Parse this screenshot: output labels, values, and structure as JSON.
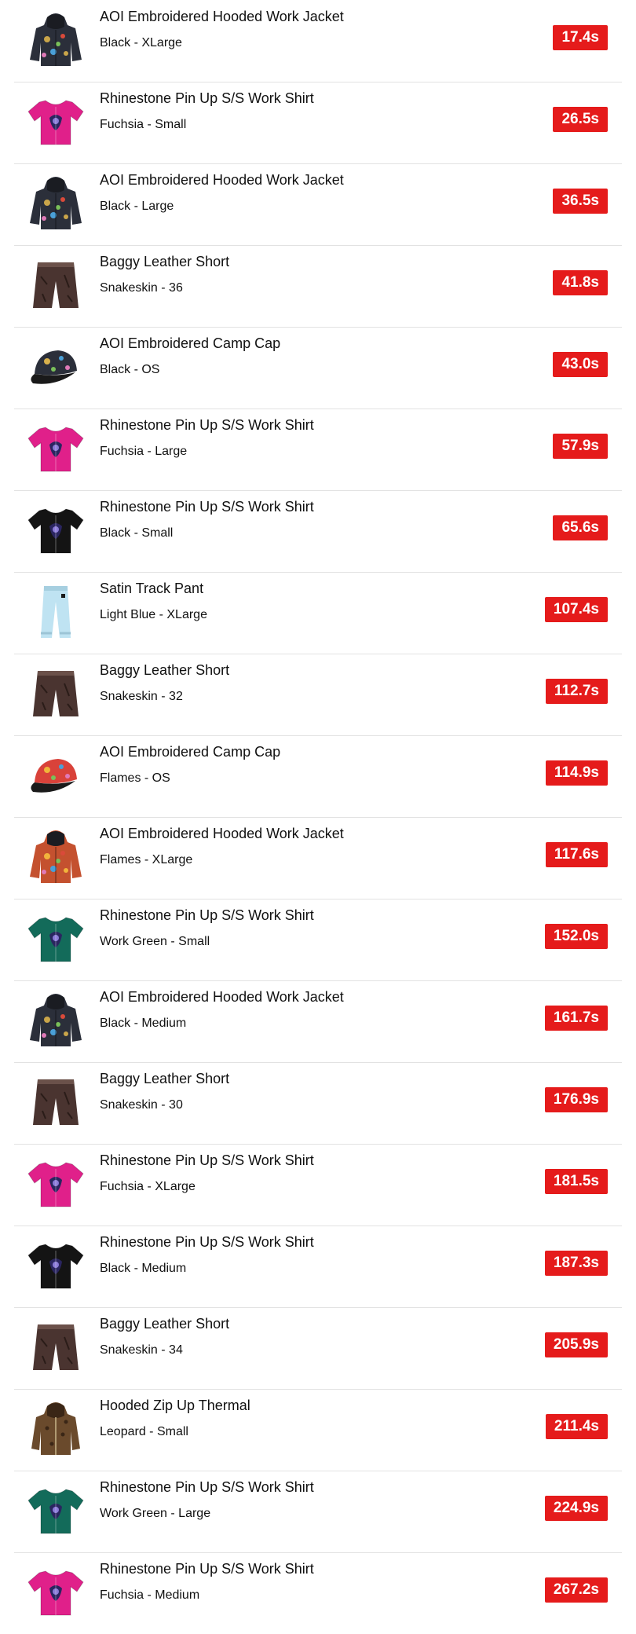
{
  "items": [
    {
      "name": "AOI Embroidered Hooded Work Jacket",
      "variant": "Black - XLarge",
      "time": "17.4s",
      "icon": "hooded-jacket-icon",
      "color": "#2b2f3a",
      "accent": "#c9a54a"
    },
    {
      "name": "Rhinestone Pin Up S/S Work Shirt",
      "variant": "Fuchsia - Small",
      "time": "26.5s",
      "icon": "shirt-icon",
      "color": "#e0208a",
      "accent": "#ffffff"
    },
    {
      "name": "AOI Embroidered Hooded Work Jacket",
      "variant": "Black - Large",
      "time": "36.5s",
      "icon": "hooded-jacket-icon",
      "color": "#2b2f3a",
      "accent": "#c9a54a"
    },
    {
      "name": "Baggy Leather Short",
      "variant": "Snakeskin - 36",
      "time": "41.8s",
      "icon": "shorts-icon",
      "color": "#4a3430",
      "accent": "#6b514a"
    },
    {
      "name": "AOI Embroidered Camp Cap",
      "variant": "Black - OS",
      "time": "43.0s",
      "icon": "cap-icon",
      "color": "#2b2f3a",
      "accent": "#d7b04c"
    },
    {
      "name": "Rhinestone Pin Up S/S Work Shirt",
      "variant": "Fuchsia - Large",
      "time": "57.9s",
      "icon": "shirt-icon",
      "color": "#e0208a",
      "accent": "#ffffff"
    },
    {
      "name": "Rhinestone Pin Up S/S Work Shirt",
      "variant": "Black - Small",
      "time": "65.6s",
      "icon": "shirt-icon",
      "color": "#141414",
      "accent": "#ffffff"
    },
    {
      "name": "Satin Track Pant",
      "variant": "Light Blue - XLarge",
      "time": "107.4s",
      "icon": "pants-icon",
      "color": "#bfe3f2",
      "accent": "#1a1a1a"
    },
    {
      "name": "Baggy Leather Short",
      "variant": "Snakeskin - 32",
      "time": "112.7s",
      "icon": "shorts-icon",
      "color": "#4a3430",
      "accent": "#6b514a"
    },
    {
      "name": "AOI Embroidered Camp Cap",
      "variant": "Flames - OS",
      "time": "114.9s",
      "icon": "cap-icon",
      "color": "#d9423a",
      "accent": "#f0b53a"
    },
    {
      "name": "AOI Embroidered Hooded Work Jacket",
      "variant": "Flames - XLarge",
      "time": "117.6s",
      "icon": "hooded-jacket-icon",
      "color": "#c4512f",
      "accent": "#f1b43c"
    },
    {
      "name": "Rhinestone Pin Up S/S Work Shirt",
      "variant": "Work Green - Small",
      "time": "152.0s",
      "icon": "shirt-icon",
      "color": "#136b5a",
      "accent": "#ffffff"
    },
    {
      "name": "AOI Embroidered Hooded Work Jacket",
      "variant": "Black - Medium",
      "time": "161.7s",
      "icon": "hooded-jacket-icon",
      "color": "#2b2f3a",
      "accent": "#c9a54a"
    },
    {
      "name": "Baggy Leather Short",
      "variant": "Snakeskin - 30",
      "time": "176.9s",
      "icon": "shorts-icon",
      "color": "#4a3430",
      "accent": "#6b514a"
    },
    {
      "name": "Rhinestone Pin Up S/S Work Shirt",
      "variant": "Fuchsia - XLarge",
      "time": "181.5s",
      "icon": "shirt-icon",
      "color": "#e0208a",
      "accent": "#ffffff"
    },
    {
      "name": "Rhinestone Pin Up S/S Work Shirt",
      "variant": "Black - Medium",
      "time": "187.3s",
      "icon": "shirt-icon",
      "color": "#141414",
      "accent": "#ffffff"
    },
    {
      "name": "Baggy Leather Short",
      "variant": "Snakeskin - 34",
      "time": "205.9s",
      "icon": "shorts-icon",
      "color": "#4a3430",
      "accent": "#6b514a"
    },
    {
      "name": "Hooded Zip Up Thermal",
      "variant": "Leopard - Small",
      "time": "211.4s",
      "icon": "zip-hoodie-icon",
      "color": "#6a4a2c",
      "accent": "#3a2616"
    },
    {
      "name": "Rhinestone Pin Up S/S Work Shirt",
      "variant": "Work Green - Large",
      "time": "224.9s",
      "icon": "shirt-icon",
      "color": "#136b5a",
      "accent": "#ffffff"
    },
    {
      "name": "Rhinestone Pin Up S/S Work Shirt",
      "variant": "Fuchsia - Medium",
      "time": "267.2s",
      "icon": "shirt-icon",
      "color": "#e0208a",
      "accent": "#ffffff"
    }
  ],
  "badge_color": "#e51b1b"
}
